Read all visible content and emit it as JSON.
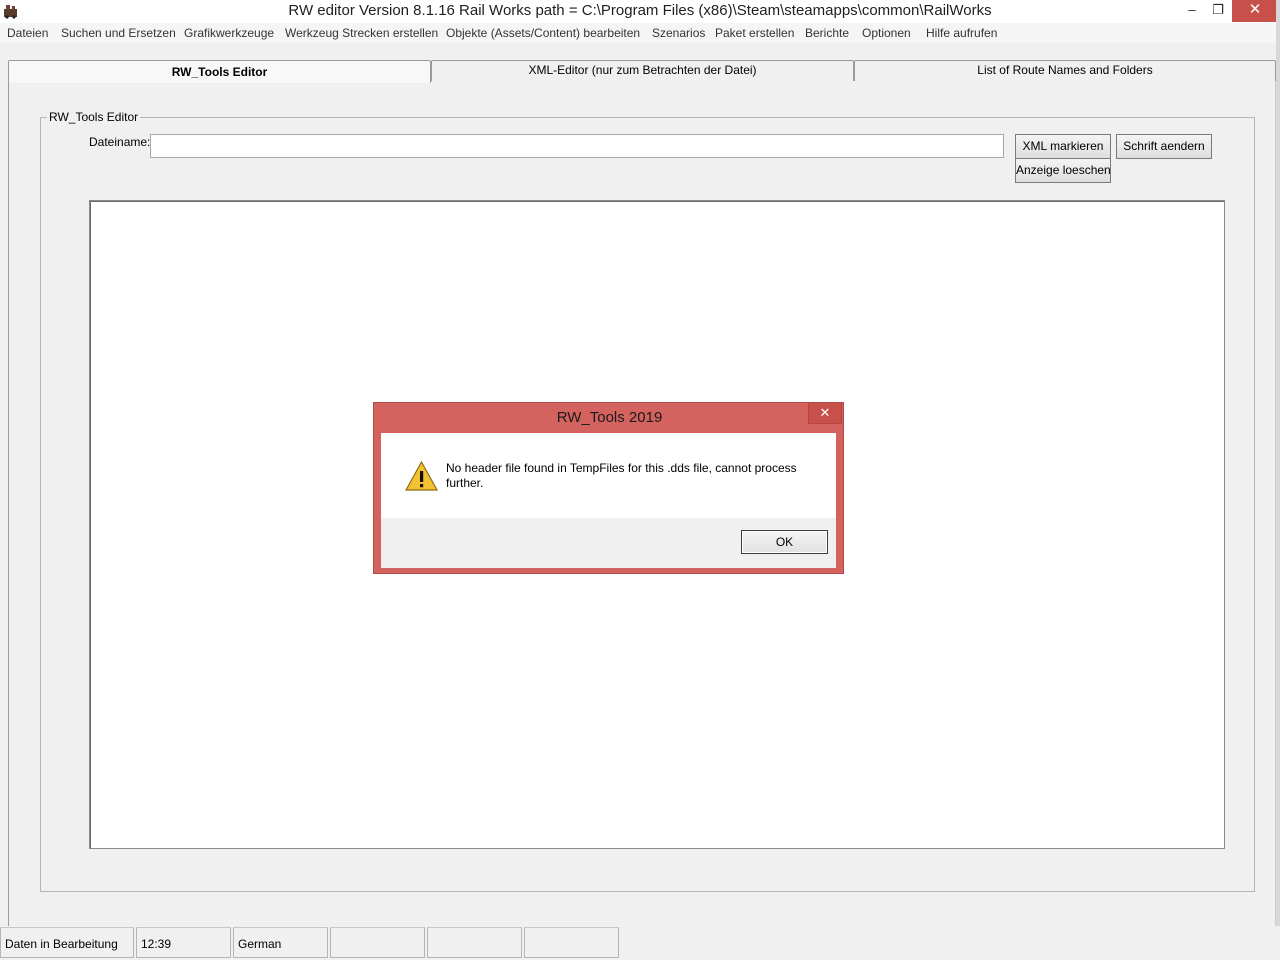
{
  "window": {
    "title": "RW editor  Version 8.1.16   Rail Works path = C:\\Program Files (x86)\\Steam\\steamapps\\common\\RailWorks",
    "min_glyph": "‒",
    "max_glyph": "❐",
    "close_glyph": "✕"
  },
  "menu": {
    "items": [
      "Dateien",
      "Suchen und Ersetzen",
      "Grafikwerkzeuge",
      "Werkzeug Strecken erstellen",
      "Objekte (Assets/Content) bearbeiten",
      "Szenarios",
      "Paket erstellen",
      "Berichte",
      "Optionen",
      "Hilfe aufrufen"
    ]
  },
  "tabs": [
    {
      "label": "RW_Tools Editor",
      "active": true
    },
    {
      "label": "XML-Editor (nur zum Betrachten der Datei)",
      "active": false
    },
    {
      "label": "List of Route Names and Folders",
      "active": false
    }
  ],
  "editor": {
    "group_title": "RW_Tools Editor",
    "filename_label": "Dateiname:",
    "filename_value": "",
    "btn_xml": "XML markieren",
    "btn_schrift": "Schrift aendern",
    "btn_anzeige": "Anzeige loeschen"
  },
  "dialog": {
    "title": "RW_Tools 2019",
    "close_glyph": "✕",
    "icon": "warning-icon",
    "message": "No header file found in TempFiles for this .dds file, cannot process further.",
    "ok_label": "OK"
  },
  "statusbar": {
    "cells": [
      "Daten in Bearbeitung",
      "12:39",
      "German",
      "",
      "",
      ""
    ]
  },
  "colors": {
    "dialog_frame": "#d4625f",
    "close_button": "#c7504a"
  }
}
